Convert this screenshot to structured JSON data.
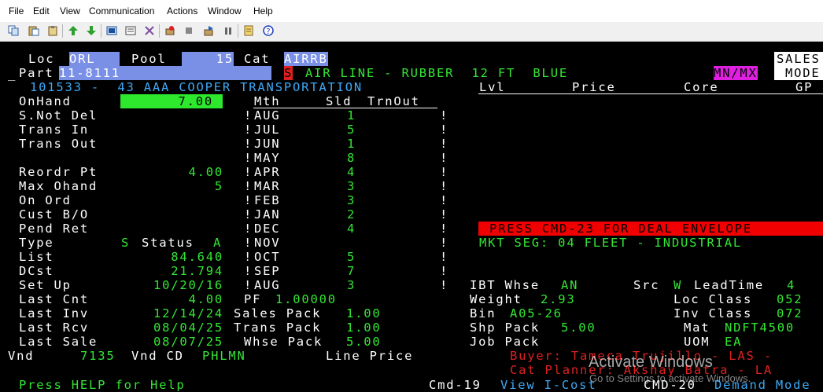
{
  "menu": [
    "File",
    "Edit",
    "View",
    "Communication",
    "Actions",
    "Window",
    "Help"
  ],
  "toolbar_icons": [
    "copy-icon",
    "paste-icon",
    "clipboard-icon",
    "send-icon",
    "receive-icon",
    "keyboard-map-icon",
    "macro-icon",
    "display-icon",
    "record-icon",
    "stop-icon",
    "play-icon",
    "pause-icon",
    "notes-icon",
    "help-icon"
  ],
  "header": {
    "loc_label": "Loc",
    "loc_value": "ORL",
    "pool_label": "Pool",
    "pool_value": "15",
    "cat_label": "Cat",
    "cat_value": "AIRRB",
    "sales_box_line1": "SALES",
    "sales_box_line2": "MODE",
    "part_label": "Part",
    "part_value": "11-8111",
    "s_flag": "S",
    "part_description": "AIR LINE - RUBBER  12 FT  BLUE",
    "mn_mx": "MN/MX",
    "vendor_line": "101533 -  43 AAA COOPER TRANSPORTATION",
    "col_lvl": "Lvl",
    "col_price": "Price",
    "col_core": "Core",
    "col_gp": "GP"
  },
  "left_labels": {
    "onhand": "OnHand",
    "snotdel": "S.Not Del",
    "transin": "Trans In",
    "transout": "Trans Out",
    "reordr": "Reordr Pt",
    "maxohand": "Max Ohand",
    "onord": "On Ord",
    "custbo": "Cust B/O",
    "pendret": "Pend Ret",
    "type": "Type",
    "status": "Status",
    "list": "List",
    "dcst": "DCst",
    "setup": "Set Up",
    "lastcnt": "Last Cnt",
    "lastinv": "Last Inv",
    "lastrcv": "Last Rcv",
    "lastsale": "Last Sale",
    "vnd": "Vnd",
    "vndcd": "Vnd CD"
  },
  "left_values": {
    "onhand": "7.00",
    "reordr": "4.00",
    "maxohand": "5",
    "type": "S",
    "status": "A",
    "list": "84.640",
    "dcst": "21.794",
    "setup": "10/20/16",
    "lastcnt": "4.00",
    "lastinv": "12/14/24",
    "lastrcv": "08/04/25",
    "lastsale": "08/07/25",
    "vnd": "7135",
    "vndcd": "PHLMN"
  },
  "sales_table": {
    "headers": [
      "Mth",
      "Sld",
      "TrnOut"
    ],
    "rows": [
      {
        "mth": "AUG",
        "sld": "1"
      },
      {
        "mth": "JUL",
        "sld": "5"
      },
      {
        "mth": "JUN",
        "sld": "1"
      },
      {
        "mth": "MAY",
        "sld": "8"
      },
      {
        "mth": "APR",
        "sld": "4"
      },
      {
        "mth": "MAR",
        "sld": "3"
      },
      {
        "mth": "FEB",
        "sld": "3"
      },
      {
        "mth": "JAN",
        "sld": "2"
      },
      {
        "mth": "DEC",
        "sld": "4"
      },
      {
        "mth": "NOV",
        "sld": ""
      },
      {
        "mth": "OCT",
        "sld": "5"
      },
      {
        "mth": "SEP",
        "sld": "7"
      },
      {
        "mth": "AUG",
        "sld": "3"
      }
    ]
  },
  "pf": {
    "label": "PF",
    "value": "1.00000"
  },
  "packs": {
    "sales_label": "Sales Pack",
    "sales_value": "1.00",
    "trans_label": "Trans Pack",
    "trans_value": "1.00",
    "whse_label": "Whse Pack",
    "whse_value": "5.00"
  },
  "line_price_label": "Line Price",
  "deal_banner": "PRESS CMD-23 FOR DEAL ENVELOPE",
  "mkt_seg": "MKT SEG: 04 FLEET - INDUSTRIAL",
  "right_info": {
    "ibt_label": "IBT Whse",
    "ibt_value": "AN",
    "src_label": "Src",
    "src_value": "W",
    "lead_label": "LeadTime",
    "lead_value": "4",
    "weight_label": "Weight",
    "weight_value": "2.93",
    "locclass_label": "Loc Class",
    "locclass_value": "052",
    "bin_label": "Bin",
    "bin_value": "A05-26",
    "invclass_label": "Inv Class",
    "invclass_value": "072",
    "shp_label": "Shp Pack",
    "shp_value": "5.00",
    "mat_label": "Mat",
    "mat_value": "NDFT4500",
    "job_label": "Job Pack",
    "uom_label": "UOM",
    "uom_value": "EA"
  },
  "buyer_line": "Buyer: Tameca Trujillo - LAS -",
  "planner_line": "Cat Planner: Akshay Batra - LA",
  "footer": {
    "help": "Press HELP for Help",
    "cmd19": "Cmd-19",
    "view": "View I-Cost",
    "cmd20": "CMD-20",
    "demand": "Demand Mode"
  },
  "watermark": {
    "title": "Activate Windows",
    "subtitle": "Go to Settings to activate Windows."
  }
}
